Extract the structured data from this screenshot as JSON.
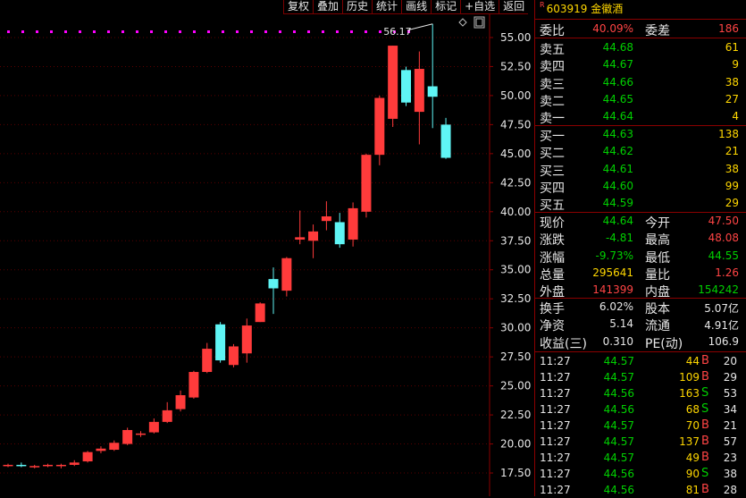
{
  "toolbar": [
    "复权",
    "叠加",
    "历史",
    "统计",
    "画线",
    "标记",
    "+自选",
    "返回"
  ],
  "chart": {
    "y_ticks": [
      "55.00",
      "52.50",
      "50.00",
      "47.50",
      "45.00",
      "42.50",
      "40.00",
      "37.50",
      "35.00",
      "32.50",
      "30.00",
      "27.50",
      "25.00",
      "22.50",
      "20.00",
      "17.50"
    ],
    "high_label": "56.17"
  },
  "chart_data": {
    "type": "candlestick",
    "ylim": [
      15.5,
      57.0
    ],
    "y_ticks": [
      55.0,
      52.5,
      50.0,
      47.5,
      45.0,
      42.5,
      40.0,
      37.5,
      35.0,
      32.5,
      30.0,
      27.5,
      25.0,
      22.5,
      20.0,
      17.5
    ],
    "annotation": "56.17",
    "candles": [
      {
        "o": 18.1,
        "h": 18.3,
        "l": 18.0,
        "c": 18.2
      },
      {
        "o": 18.2,
        "h": 18.4,
        "l": 18.0,
        "c": 18.1
      },
      {
        "o": 18.0,
        "h": 18.2,
        "l": 17.9,
        "c": 18.1
      },
      {
        "o": 18.1,
        "h": 18.3,
        "l": 18.0,
        "c": 18.2
      },
      {
        "o": 18.1,
        "h": 18.3,
        "l": 17.9,
        "c": 18.2
      },
      {
        "o": 18.2,
        "h": 18.6,
        "l": 18.1,
        "c": 18.4
      },
      {
        "o": 18.5,
        "h": 19.4,
        "l": 18.4,
        "c": 19.3
      },
      {
        "o": 19.4,
        "h": 19.8,
        "l": 19.2,
        "c": 19.6
      },
      {
        "o": 19.5,
        "h": 20.3,
        "l": 19.4,
        "c": 20.1
      },
      {
        "o": 20.0,
        "h": 21.4,
        "l": 19.9,
        "c": 21.2
      },
      {
        "o": 20.8,
        "h": 21.1,
        "l": 20.6,
        "c": 20.9
      },
      {
        "o": 21.0,
        "h": 22.2,
        "l": 20.9,
        "c": 21.9
      },
      {
        "o": 21.9,
        "h": 23.6,
        "l": 21.8,
        "c": 22.9
      },
      {
        "o": 23.0,
        "h": 24.6,
        "l": 22.8,
        "c": 24.2
      },
      {
        "o": 24.0,
        "h": 26.3,
        "l": 23.9,
        "c": 26.2
      },
      {
        "o": 26.2,
        "h": 28.7,
        "l": 26.1,
        "c": 28.2
      },
      {
        "o": 30.3,
        "h": 30.5,
        "l": 27.0,
        "c": 27.2
      },
      {
        "o": 26.8,
        "h": 28.6,
        "l": 26.6,
        "c": 28.4
      },
      {
        "o": 27.8,
        "h": 30.8,
        "l": 27.0,
        "c": 30.2
      },
      {
        "o": 30.5,
        "h": 32.2,
        "l": 30.5,
        "c": 32.1
      },
      {
        "o": 34.2,
        "h": 35.2,
        "l": 31.2,
        "c": 33.4
      },
      {
        "o": 33.2,
        "h": 36.1,
        "l": 32.7,
        "c": 36.0
      },
      {
        "o": 37.6,
        "h": 40.1,
        "l": 37.2,
        "c": 37.8
      },
      {
        "o": 37.5,
        "h": 38.9,
        "l": 36.0,
        "c": 38.3
      },
      {
        "o": 39.2,
        "h": 40.9,
        "l": 38.4,
        "c": 39.6
      },
      {
        "o": 39.1,
        "h": 39.9,
        "l": 36.9,
        "c": 37.2
      },
      {
        "o": 37.6,
        "h": 40.8,
        "l": 37.0,
        "c": 40.3
      },
      {
        "o": 40.0,
        "h": 45.0,
        "l": 39.5,
        "c": 44.9
      },
      {
        "o": 44.9,
        "h": 50.0,
        "l": 44.0,
        "c": 49.8
      },
      {
        "o": 48.0,
        "h": 54.3,
        "l": 47.3,
        "c": 54.3
      },
      {
        "o": 52.2,
        "h": 52.5,
        "l": 49.1,
        "c": 49.4
      },
      {
        "o": 48.6,
        "h": 53.8,
        "l": 45.8,
        "c": 52.3
      },
      {
        "o": 50.8,
        "h": 56.17,
        "l": 47.2,
        "c": 49.9
      },
      {
        "o": 47.5,
        "h": 48.08,
        "l": 44.55,
        "c": 44.64
      }
    ]
  },
  "quote": {
    "r_badge": "R",
    "code": "603919",
    "name": "金徽酒",
    "weibi_label": "委比",
    "weibi_value": "40.09%",
    "weicha_label": "委差",
    "weicha_value": "186",
    "asks": [
      {
        "label": "卖五",
        "price": "44.68",
        "vol": "61"
      },
      {
        "label": "卖四",
        "price": "44.67",
        "vol": "9"
      },
      {
        "label": "卖三",
        "price": "44.66",
        "vol": "38"
      },
      {
        "label": "卖二",
        "price": "44.65",
        "vol": "27"
      },
      {
        "label": "卖一",
        "price": "44.64",
        "vol": "4"
      }
    ],
    "bids": [
      {
        "label": "买一",
        "price": "44.63",
        "vol": "138"
      },
      {
        "label": "买二",
        "price": "44.62",
        "vol": "21"
      },
      {
        "label": "买三",
        "price": "44.61",
        "vol": "38"
      },
      {
        "label": "买四",
        "price": "44.60",
        "vol": "99"
      },
      {
        "label": "买五",
        "price": "44.59",
        "vol": "29"
      }
    ],
    "stats1": [
      {
        "l1": "现价",
        "v1": "44.64",
        "c1": "green",
        "l2": "今开",
        "v2": "47.50",
        "c2": "red"
      },
      {
        "l1": "涨跌",
        "v1": "-4.81",
        "c1": "green",
        "l2": "最高",
        "v2": "48.08",
        "c2": "red"
      },
      {
        "l1": "涨幅",
        "v1": "-9.73%",
        "c1": "green",
        "l2": "最低",
        "v2": "44.55",
        "c2": "green"
      },
      {
        "l1": "总量",
        "v1": "295641",
        "c1": "yellow",
        "l2": "量比",
        "v2": "1.26",
        "c2": "red"
      },
      {
        "l1": "外盘",
        "v1": "141399",
        "c1": "red",
        "l2": "内盘",
        "v2": "154242",
        "c2": "green"
      }
    ],
    "stats2": [
      {
        "l1": "换手",
        "v1": "6.02%",
        "c1": "white",
        "l2": "股本",
        "v2": "5.07亿",
        "c2": "white"
      },
      {
        "l1": "净资",
        "v1": "5.14",
        "c1": "white",
        "l2": "流通",
        "v2": "4.91亿",
        "c2": "white"
      },
      {
        "l1": "收益(三)",
        "v1": "0.310",
        "c1": "white",
        "l2": "PE(动)",
        "v2": "106.9",
        "c2": "white"
      }
    ],
    "ticks": [
      {
        "time": "11:27",
        "price": "44.57",
        "vol": "44",
        "bs": "B",
        "n": "20"
      },
      {
        "time": "11:27",
        "price": "44.57",
        "vol": "109",
        "bs": "B",
        "n": "29"
      },
      {
        "time": "11:27",
        "price": "44.56",
        "vol": "163",
        "bs": "S",
        "n": "53"
      },
      {
        "time": "11:27",
        "price": "44.56",
        "vol": "68",
        "bs": "S",
        "n": "34"
      },
      {
        "time": "11:27",
        "price": "44.57",
        "vol": "70",
        "bs": "B",
        "n": "21"
      },
      {
        "time": "11:27",
        "price": "44.57",
        "vol": "137",
        "bs": "B",
        "n": "57"
      },
      {
        "time": "11:27",
        "price": "44.57",
        "vol": "49",
        "bs": "B",
        "n": "23"
      },
      {
        "time": "11:27",
        "price": "44.56",
        "vol": "90",
        "bs": "S",
        "n": "38"
      },
      {
        "time": "11:27",
        "price": "44.56",
        "vol": "81",
        "bs": "B",
        "n": "28"
      }
    ]
  },
  "colors": {
    "up": "#ff3b3b",
    "down": "#5ff5f5",
    "grid": "#5a0000",
    "axis": "#8b0000",
    "dots": "#ff00ff"
  }
}
